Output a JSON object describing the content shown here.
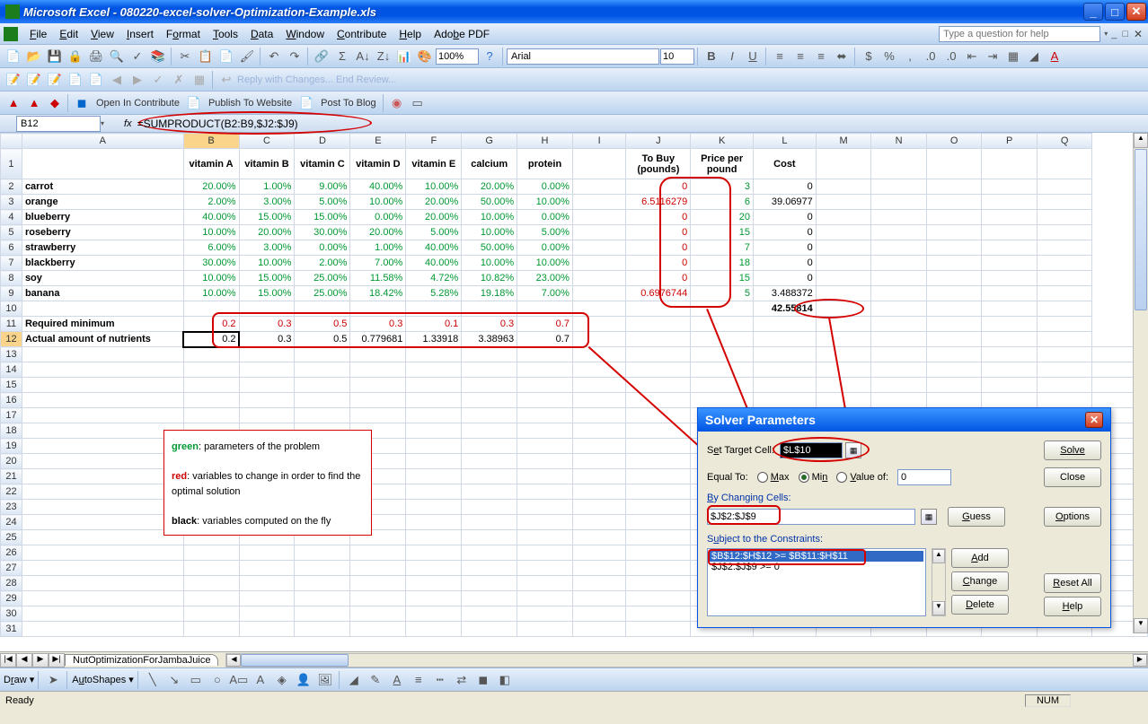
{
  "title": "Microsoft Excel - 080220-excel-solver-Optimization-Example.xls",
  "menus": [
    "File",
    "Edit",
    "View",
    "Insert",
    "Format",
    "Tools",
    "Data",
    "Window",
    "Contribute",
    "Help",
    "Adobe PDF"
  ],
  "help_placeholder": "Type a question for help",
  "zoom": "100%",
  "font_name": "Arial",
  "font_size": "10",
  "reply_text": "Reply with Changes... End Review...",
  "contribute": {
    "open": "Open In Contribute",
    "publish": "Publish To Website",
    "post": "Post To Blog"
  },
  "name_box": "B12",
  "formula": "=SUMPRODUCT(B2:B9,$J2:$J9)",
  "columns": [
    "",
    "A",
    "B",
    "C",
    "D",
    "E",
    "F",
    "G",
    "H",
    "I",
    "J",
    "K",
    "L",
    "M",
    "N",
    "O",
    "P",
    "Q"
  ],
  "nutrient_headers": [
    "vitamin A",
    "vitamin B",
    "vitamin C",
    "vitamin D",
    "vitamin E",
    "calcium",
    "protein"
  ],
  "extra_headers": {
    "J1": "To Buy (pounds)",
    "K1": "Price per pound",
    "L1": "Cost"
  },
  "foods": [
    {
      "name": "carrot",
      "nut": [
        "20.00%",
        "1.00%",
        "9.00%",
        "40.00%",
        "10.00%",
        "20.00%",
        "0.00%"
      ],
      "buy": "0",
      "price": "3",
      "cost": "0"
    },
    {
      "name": "orange",
      "nut": [
        "2.00%",
        "3.00%",
        "5.00%",
        "10.00%",
        "20.00%",
        "50.00%",
        "10.00%"
      ],
      "buy": "6.5116279",
      "price": "6",
      "cost": "39.06977"
    },
    {
      "name": "blueberry",
      "nut": [
        "40.00%",
        "15.00%",
        "15.00%",
        "0.00%",
        "20.00%",
        "10.00%",
        "0.00%"
      ],
      "buy": "0",
      "price": "20",
      "cost": "0"
    },
    {
      "name": "roseberry",
      "nut": [
        "10.00%",
        "20.00%",
        "30.00%",
        "20.00%",
        "5.00%",
        "10.00%",
        "5.00%"
      ],
      "buy": "0",
      "price": "15",
      "cost": "0"
    },
    {
      "name": "strawberry",
      "nut": [
        "6.00%",
        "3.00%",
        "0.00%",
        "1.00%",
        "40.00%",
        "50.00%",
        "0.00%"
      ],
      "buy": "0",
      "price": "7",
      "cost": "0"
    },
    {
      "name": "blackberry",
      "nut": [
        "30.00%",
        "10.00%",
        "2.00%",
        "7.00%",
        "40.00%",
        "10.00%",
        "10.00%"
      ],
      "buy": "0",
      "price": "18",
      "cost": "0"
    },
    {
      "name": "soy",
      "nut": [
        "10.00%",
        "15.00%",
        "25.00%",
        "11.58%",
        "4.72%",
        "10.82%",
        "23.00%"
      ],
      "buy": "0",
      "price": "15",
      "cost": "0"
    },
    {
      "name": "banana",
      "nut": [
        "10.00%",
        "15.00%",
        "25.00%",
        "18.42%",
        "5.28%",
        "19.18%",
        "7.00%"
      ],
      "buy": "0.6976744",
      "price": "5",
      "cost": "3.488372"
    }
  ],
  "total_cost": "42.55814",
  "row11_label": "Required minimum",
  "required": [
    "0.2",
    "0.3",
    "0.5",
    "0.3",
    "0.1",
    "0.3",
    "0.7"
  ],
  "row12_label": "Actual amount of nutrients",
  "actual": [
    "0.2",
    "0.3",
    "0.5",
    "0.779681",
    "1.33918",
    "3.38963",
    "0.7"
  ],
  "legend": {
    "g_label": "green",
    "g_text": ": parameters of the problem",
    "r_label": "red",
    "r_text": ": variables to change in order to find the optimal solution",
    "b_label": "black",
    "b_text": ": variables computed on the fly"
  },
  "solver": {
    "title": "Solver Parameters",
    "set_target": "Set Target Cell:",
    "target_ref": "$L$10",
    "equal_to": "Equal To:",
    "opt_max": "Max",
    "opt_min": "Min",
    "opt_value": "Value of:",
    "value_of": "0",
    "by_changing": "By Changing Cells:",
    "changing_ref": "$J$2:$J$9",
    "subject": "Subject to the Constraints:",
    "constraints": [
      "$B$12:$H$12 >= $B$11:$H$11",
      "$J$2:$J$9 >= 0"
    ],
    "btn_solve": "Solve",
    "btn_close": "Close",
    "btn_guess": "Guess",
    "btn_options": "Options",
    "btn_add": "Add",
    "btn_change": "Change",
    "btn_delete": "Delete",
    "btn_reset": "Reset All",
    "btn_help": "Help"
  },
  "sheet_tab": "NutOptimizationForJambaJuice",
  "draw_label": "Draw",
  "autoshapes": "AutoShapes",
  "status": "Ready",
  "status_num": "NUM"
}
